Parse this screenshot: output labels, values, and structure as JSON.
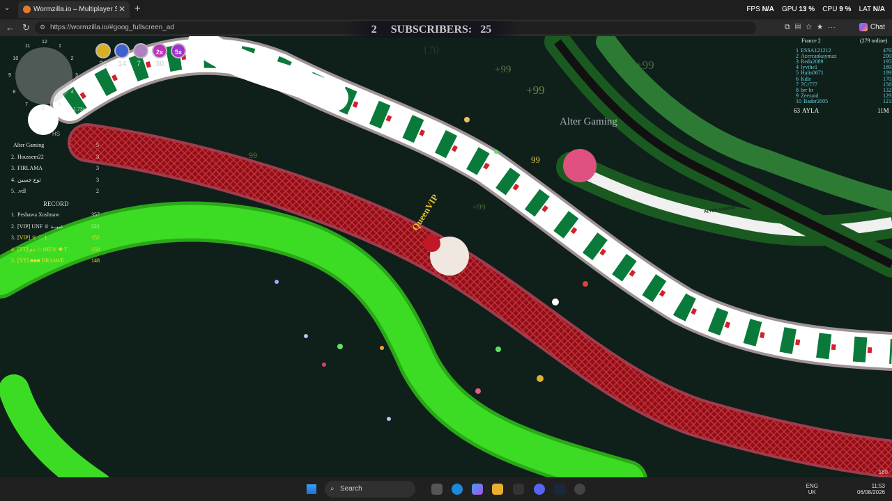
{
  "browser": {
    "tab_title": "Wormzilla.io – Multiplayer Snake G",
    "url": "https://wormzilla.io/#goog_fullscreen_ad",
    "stats": {
      "fps_label": "FPS",
      "fps_value": "N/A",
      "gpu_label": "GPU",
      "gpu_value": "13 %",
      "cpu_label": "CPU",
      "cpu_value": "9 %",
      "lat_label": "LAT",
      "lat_value": "N/A"
    },
    "chat_label": "Chat"
  },
  "overlay": {
    "count": "2",
    "subscribers_label": "SUBSCRIBERS:",
    "subscribers_value": "25"
  },
  "powerups": [
    {
      "name": "speed-boost-icon",
      "color": "#d8b020",
      "timer": "30"
    },
    {
      "name": "magnet-icon",
      "color": "#4060d0",
      "timer": "14"
    },
    {
      "name": "magnet-icon",
      "color": "#b080c0",
      "timer": "7"
    },
    {
      "name": "double-icon",
      "color": "#c030c0",
      "label": "2x",
      "timer": "30"
    },
    {
      "name": "quintuple-icon",
      "color": "#a030d0",
      "label": "5x",
      "timer": ""
    }
  ],
  "clock": {
    "numbers": [
      "12",
      "1",
      "2",
      "3",
      "4",
      "5",
      "6",
      "7",
      "8",
      "9",
      "10",
      "11"
    ]
  },
  "zoom": "1.73x",
  "hs_label": "HS",
  "kills_board": [
    {
      "rank": "",
      "name": "Alter Gaming",
      "score": "5"
    },
    {
      "rank": "2.",
      "name": "Houssem22",
      "score": "3"
    },
    {
      "rank": "3.",
      "name": "FIRLAMA",
      "score": "3"
    },
    {
      "rank": "4.",
      "name": "ثوع جسين",
      "score": "3"
    },
    {
      "rank": "5.",
      "name": ".vdl",
      "score": "2"
    }
  ],
  "record_label": "RECORD",
  "record_board": [
    {
      "rank": "1.",
      "name": "Peshawa Xoshnaw",
      "score": "357",
      "color": "#e0e0e0"
    },
    {
      "rank": "2.",
      "name": "[VIP] UNF ♕ عبيــد",
      "score": "221",
      "color": "#e0e0e0"
    },
    {
      "rank": "3.",
      "name": "[VIP] ♕ ♡ 1",
      "score": "152",
      "color": "#e8e030"
    },
    {
      "rank": "4.",
      "name": "[TT] دم ☆ rRT♕ ✚ T",
      "score": "150",
      "color": "#e8e030"
    },
    {
      "rank": "5.",
      "name": "[YT] ■■■ DR3AWE",
      "score": "148",
      "color": "#e8e030"
    }
  ],
  "server": {
    "name": "France 2",
    "online": "(279 online)"
  },
  "leaderboard": [
    {
      "rank": "1",
      "name": "ESSA121212",
      "score": "476M"
    },
    {
      "rank": "2",
      "name": "Azercankaymaz",
      "score": "200M"
    },
    {
      "rank": "3",
      "name": "Reda2089",
      "score": "195M"
    },
    {
      "rank": "4",
      "name": "lyvthe1",
      "score": "189M"
    },
    {
      "rank": "5",
      "name": "Halis0671",
      "score": "189M"
    },
    {
      "rank": "6",
      "name": "Kdir",
      "score": "170M"
    },
    {
      "rank": "7",
      "name": "7Cr777",
      "score": "158M"
    },
    {
      "rank": "8",
      "name": "brr br",
      "score": "132M"
    },
    {
      "rank": "9",
      "name": "Zeezaid",
      "score": "129M"
    },
    {
      "rank": "10",
      "name": "Bader2005",
      "score": "121M"
    }
  ],
  "player_rank": {
    "rank": "63",
    "name": "AYLA",
    "score": "11M"
  },
  "world": {
    "floating": [
      "+99",
      "+99",
      "+99",
      "+99",
      "99",
      "170",
      "99"
    ],
    "snake_name_1": "QueenVIP",
    "snake_name_2": "Alter Gaming",
    "snake_banner_text": "ALTER GAMING",
    "corner_number": "180"
  },
  "taskbar": {
    "search_placeholder": "Search",
    "lang_1": "ENG",
    "lang_2": "UK",
    "time": "11:53",
    "date": "06/08/2026"
  },
  "colors": {
    "green_snake": "#39d822",
    "red_snake": "#a3141e",
    "flag_green": "#0a7a3a",
    "flag_red": "#d4202a"
  }
}
